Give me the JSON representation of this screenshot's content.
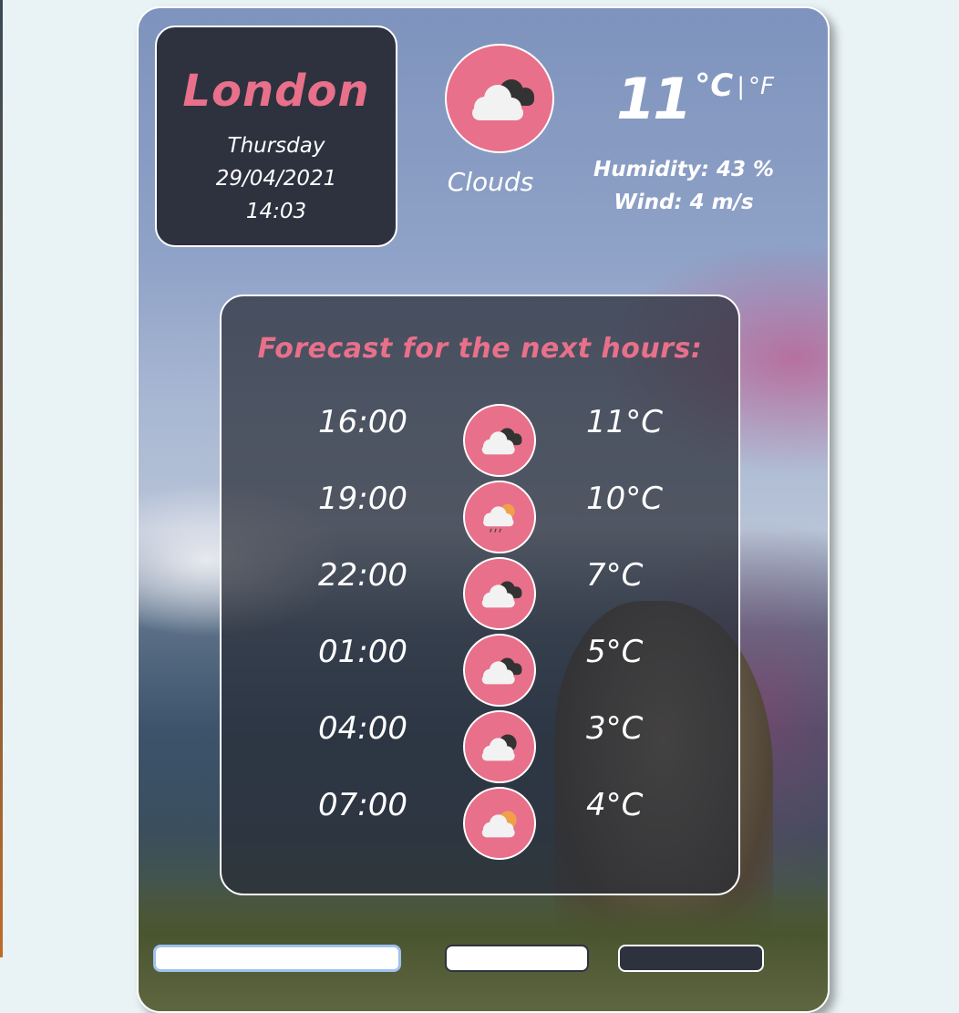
{
  "current": {
    "city": "London",
    "day": "Thursday",
    "date": "29/04/2021",
    "time": "14:03",
    "icon": "cloud-dark-icon",
    "condition": "Clouds",
    "temperature": "11",
    "unit_celsius": "°C",
    "unit_separator": "|",
    "unit_fahrenheit": "°F",
    "humidity": "Humidity: 43 %",
    "wind": "Wind: 4 m/s"
  },
  "forecast": {
    "title": "Forecast for the next hours:",
    "items": [
      {
        "time": "16:00",
        "icon": "cloud-dark-icon",
        "temp": "11°C"
      },
      {
        "time": "19:00",
        "icon": "rain-sun-icon",
        "temp": "10°C"
      },
      {
        "time": "22:00",
        "icon": "cloud-dark-icon",
        "temp": "7°C"
      },
      {
        "time": "01:00",
        "icon": "cloud-dark-icon",
        "temp": "5°C"
      },
      {
        "time": "04:00",
        "icon": "cloud-moon-icon",
        "temp": "3°C"
      },
      {
        "time": "07:00",
        "icon": "cloud-sun-icon",
        "temp": "4°C"
      }
    ]
  },
  "colors": {
    "accent": "#e9708a",
    "panel": "#2e323f",
    "page_background": "#e9f3f5"
  }
}
